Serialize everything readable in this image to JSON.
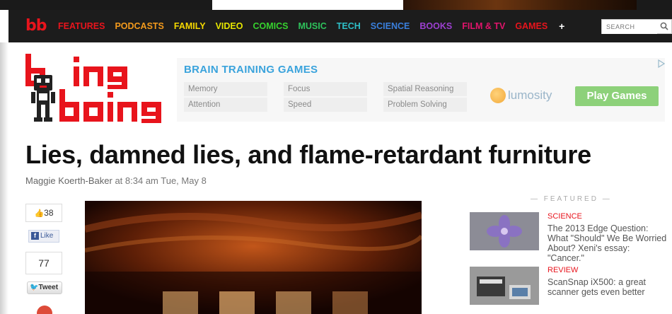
{
  "nav": {
    "logo": "bb",
    "items": [
      {
        "label": "FEATURES",
        "color": "#e8141c"
      },
      {
        "label": "PODCASTS",
        "color": "#f39a1c"
      },
      {
        "label": "FAMILY",
        "color": "#f5d800"
      },
      {
        "label": "VIDEO",
        "color": "#e6e600"
      },
      {
        "label": "COMICS",
        "color": "#36d12e"
      },
      {
        "label": "MUSIC",
        "color": "#2ec25b"
      },
      {
        "label": "TECH",
        "color": "#2ebfc7"
      },
      {
        "label": "SCIENCE",
        "color": "#3a7fdc"
      },
      {
        "label": "BOOKS",
        "color": "#9c3fd0"
      },
      {
        "label": "FILM & TV",
        "color": "#e0146b"
      },
      {
        "label": "GAMES",
        "color": "#e8141c"
      }
    ],
    "plus": "+",
    "search_placeholder": "SEARCH",
    "search_icon": "search-icon"
  },
  "brand": {
    "logo_text": "boing boing",
    "accent": "#e8141c"
  },
  "ad": {
    "title": "BRAIN TRAINING GAMES",
    "cells": [
      "Memory",
      "Focus",
      "Spatial Reasoning",
      "Attention",
      "Speed",
      "Problem Solving"
    ],
    "logo_text": "lumosity",
    "button_label": "Play Games",
    "choice_icon": "adchoices-icon"
  },
  "article": {
    "headline": "Lies, damned lies, and flame-retardant furniture",
    "author": "Maggie Koerth-Baker",
    "byline_rest": " at 8:34 am Tue, May 8"
  },
  "share": {
    "like_count": "38",
    "like_label": "Like",
    "tweet_count": "77",
    "tweet_label": "Tweet"
  },
  "featured": {
    "heading": "— FEATURED —",
    "items": [
      {
        "category": "SCIENCE",
        "text": "The 2013 Edge Question: What \"Should\" We Be Worried About? Xeni's essay: \"Cancer.\""
      },
      {
        "category": "REVIEW",
        "text": "ScanSnap iX500: a great scanner gets even better"
      }
    ]
  }
}
